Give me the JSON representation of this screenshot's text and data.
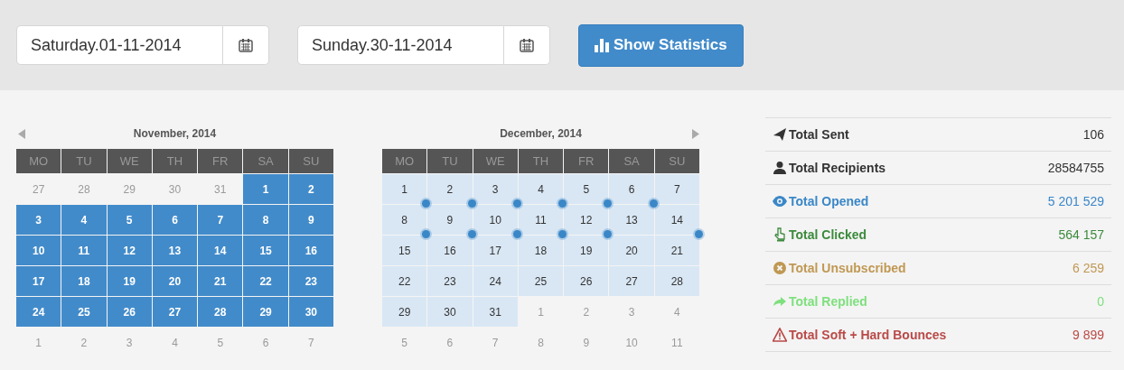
{
  "date_fields": [
    {
      "value": "Saturday.01-11-2014"
    },
    {
      "value": "Sunday.30-11-2014"
    }
  ],
  "show_button": {
    "label": "Show Statistics"
  },
  "calendars": [
    {
      "title": "November, 2014",
      "weekdays": [
        "MO",
        "TU",
        "WE",
        "TH",
        "FR",
        "SA",
        "SU"
      ],
      "weeks": [
        [
          {
            "label": "27",
            "kind": "outside",
            "marked": false
          },
          {
            "label": "28",
            "kind": "outside",
            "marked": false
          },
          {
            "label": "29",
            "kind": "outside",
            "marked": false
          },
          {
            "label": "30",
            "kind": "outside",
            "marked": false
          },
          {
            "label": "31",
            "kind": "outside",
            "marked": false
          },
          {
            "label": "1",
            "kind": "selected",
            "marked": false
          },
          {
            "label": "2",
            "kind": "selected",
            "marked": false
          }
        ],
        [
          {
            "label": "3",
            "kind": "selected",
            "marked": false
          },
          {
            "label": "4",
            "kind": "selected",
            "marked": false
          },
          {
            "label": "5",
            "kind": "selected",
            "marked": false
          },
          {
            "label": "6",
            "kind": "selected",
            "marked": false
          },
          {
            "label": "7",
            "kind": "selected",
            "marked": false
          },
          {
            "label": "8",
            "kind": "selected",
            "marked": false
          },
          {
            "label": "9",
            "kind": "selected",
            "marked": false
          }
        ],
        [
          {
            "label": "10",
            "kind": "selected",
            "marked": false
          },
          {
            "label": "11",
            "kind": "selected",
            "marked": false
          },
          {
            "label": "12",
            "kind": "selected",
            "marked": false
          },
          {
            "label": "13",
            "kind": "selected",
            "marked": false
          },
          {
            "label": "14",
            "kind": "selected",
            "marked": false
          },
          {
            "label": "15",
            "kind": "selected",
            "marked": false
          },
          {
            "label": "16",
            "kind": "selected",
            "marked": false
          }
        ],
        [
          {
            "label": "17",
            "kind": "selected",
            "marked": false
          },
          {
            "label": "18",
            "kind": "selected",
            "marked": false
          },
          {
            "label": "19",
            "kind": "selected",
            "marked": false
          },
          {
            "label": "20",
            "kind": "selected",
            "marked": false
          },
          {
            "label": "21",
            "kind": "selected",
            "marked": false
          },
          {
            "label": "22",
            "kind": "selected",
            "marked": false
          },
          {
            "label": "23",
            "kind": "selected",
            "marked": false
          }
        ],
        [
          {
            "label": "24",
            "kind": "selected",
            "marked": false
          },
          {
            "label": "25",
            "kind": "selected",
            "marked": false
          },
          {
            "label": "26",
            "kind": "selected",
            "marked": false
          },
          {
            "label": "27",
            "kind": "selected",
            "marked": false
          },
          {
            "label": "28",
            "kind": "selected",
            "marked": false
          },
          {
            "label": "29",
            "kind": "selected",
            "marked": false
          },
          {
            "label": "30",
            "kind": "selected",
            "marked": false
          }
        ],
        [
          {
            "label": "1",
            "kind": "outside",
            "marked": false
          },
          {
            "label": "2",
            "kind": "outside",
            "marked": false
          },
          {
            "label": "3",
            "kind": "outside",
            "marked": false
          },
          {
            "label": "4",
            "kind": "outside",
            "marked": false
          },
          {
            "label": "5",
            "kind": "outside",
            "marked": false
          },
          {
            "label": "6",
            "kind": "outside",
            "marked": false
          },
          {
            "label": "7",
            "kind": "outside",
            "marked": false
          }
        ]
      ]
    },
    {
      "title": "December, 2014",
      "weekdays": [
        "MO",
        "TU",
        "WE",
        "TH",
        "FR",
        "SA",
        "SU"
      ],
      "weeks": [
        [
          {
            "label": "1",
            "kind": "range",
            "marked": true
          },
          {
            "label": "2",
            "kind": "range",
            "marked": true
          },
          {
            "label": "3",
            "kind": "range",
            "marked": true
          },
          {
            "label": "4",
            "kind": "range",
            "marked": true
          },
          {
            "label": "5",
            "kind": "range",
            "marked": true
          },
          {
            "label": "6",
            "kind": "range",
            "marked": true
          },
          {
            "label": "7",
            "kind": "range",
            "marked": false
          }
        ],
        [
          {
            "label": "8",
            "kind": "range",
            "marked": true
          },
          {
            "label": "9",
            "kind": "range",
            "marked": true
          },
          {
            "label": "10",
            "kind": "range",
            "marked": true
          },
          {
            "label": "11",
            "kind": "range",
            "marked": true
          },
          {
            "label": "12",
            "kind": "range",
            "marked": true
          },
          {
            "label": "13",
            "kind": "range",
            "marked": false
          },
          {
            "label": "14",
            "kind": "range",
            "marked": true
          }
        ],
        [
          {
            "label": "15",
            "kind": "range",
            "marked": false
          },
          {
            "label": "16",
            "kind": "range",
            "marked": false
          },
          {
            "label": "17",
            "kind": "range",
            "marked": false
          },
          {
            "label": "18",
            "kind": "range",
            "marked": false
          },
          {
            "label": "19",
            "kind": "range",
            "marked": false
          },
          {
            "label": "20",
            "kind": "range",
            "marked": false
          },
          {
            "label": "21",
            "kind": "range",
            "marked": false
          }
        ],
        [
          {
            "label": "22",
            "kind": "range",
            "marked": false
          },
          {
            "label": "23",
            "kind": "range",
            "marked": false
          },
          {
            "label": "24",
            "kind": "range",
            "marked": false
          },
          {
            "label": "25",
            "kind": "range",
            "marked": false
          },
          {
            "label": "26",
            "kind": "range",
            "marked": false
          },
          {
            "label": "27",
            "kind": "range",
            "marked": false
          },
          {
            "label": "28",
            "kind": "range",
            "marked": false
          }
        ],
        [
          {
            "label": "29",
            "kind": "range",
            "marked": false
          },
          {
            "label": "30",
            "kind": "range",
            "marked": false
          },
          {
            "label": "31",
            "kind": "range",
            "marked": false
          },
          {
            "label": "1",
            "kind": "outside",
            "marked": false
          },
          {
            "label": "2",
            "kind": "outside",
            "marked": false
          },
          {
            "label": "3",
            "kind": "outside",
            "marked": false
          },
          {
            "label": "4",
            "kind": "outside",
            "marked": false
          }
        ],
        [
          {
            "label": "5",
            "kind": "outside",
            "marked": false
          },
          {
            "label": "6",
            "kind": "outside",
            "marked": false
          },
          {
            "label": "7",
            "kind": "outside",
            "marked": false
          },
          {
            "label": "8",
            "kind": "outside",
            "marked": false
          },
          {
            "label": "9",
            "kind": "outside",
            "marked": false
          },
          {
            "label": "10",
            "kind": "outside",
            "marked": false
          },
          {
            "label": "11",
            "kind": "outside",
            "marked": false
          }
        ]
      ]
    }
  ],
  "stats": [
    {
      "label": "Total Sent",
      "value": "106",
      "color": "#333333"
    },
    {
      "label": "Total Recipients",
      "value": "28584755",
      "color": "#333333"
    },
    {
      "label": "Total Opened",
      "value": "5 201 529",
      "color": "#3a87c8"
    },
    {
      "label": "Total Clicked",
      "value": "564 157",
      "color": "#3c8a3c"
    },
    {
      "label": "Total Unsubscribed",
      "value": "6 259",
      "color": "#c09853"
    },
    {
      "label": "Total Replied",
      "value": "0",
      "color": "#7ee07e"
    },
    {
      "label": "Total Soft + Hard Bounces",
      "value": "9 899",
      "color": "#b94a48"
    }
  ]
}
